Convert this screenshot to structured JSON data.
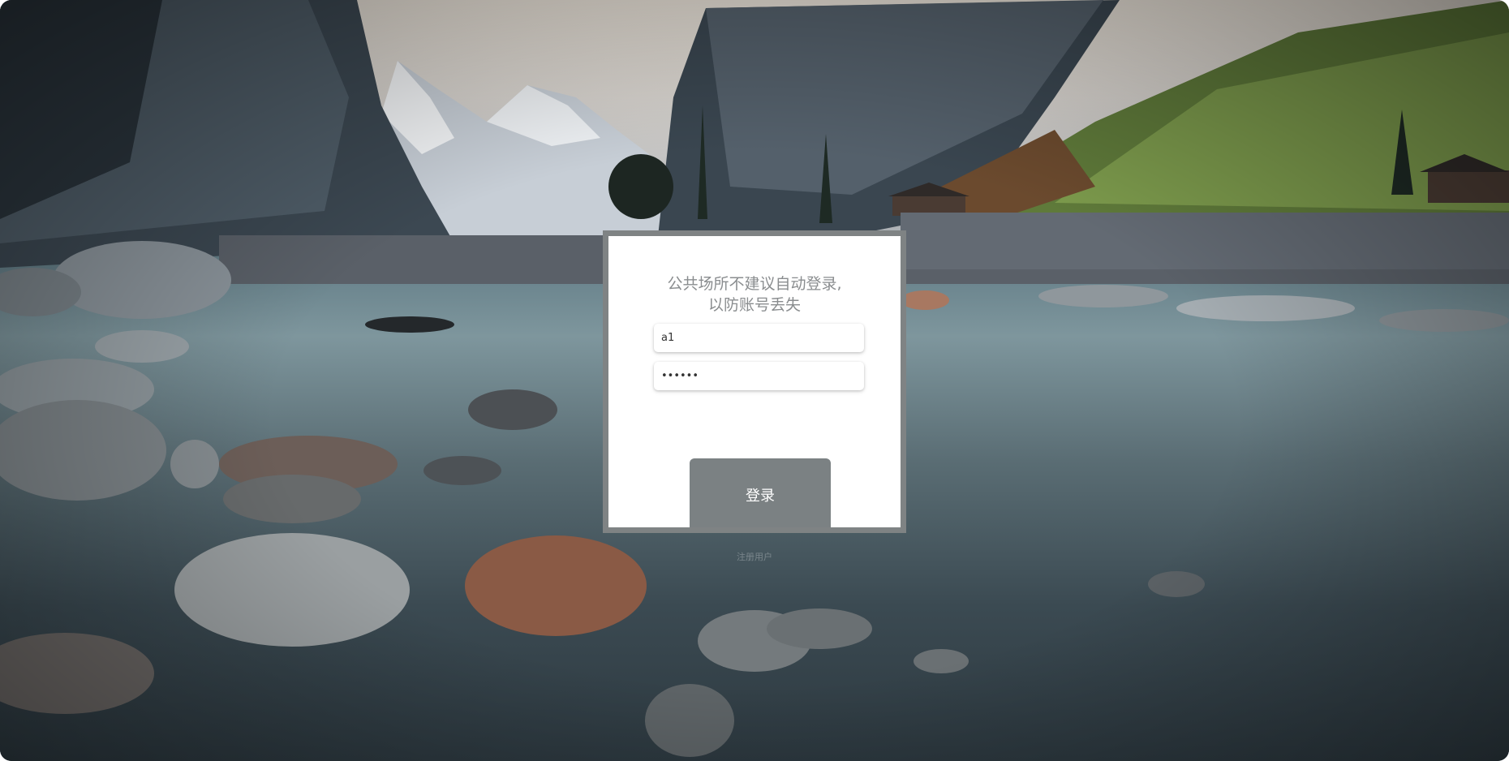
{
  "login": {
    "notice_line1": "公共场所不建议自动登录,",
    "notice_line2": "以防账号丢失",
    "username_value": "a1",
    "password_value": "••••••",
    "login_label": "登录",
    "register_label": "注册用户"
  },
  "colors": {
    "frame": "#7f8384",
    "button": "#7b8183",
    "notice_text": "#8a8d8f"
  }
}
